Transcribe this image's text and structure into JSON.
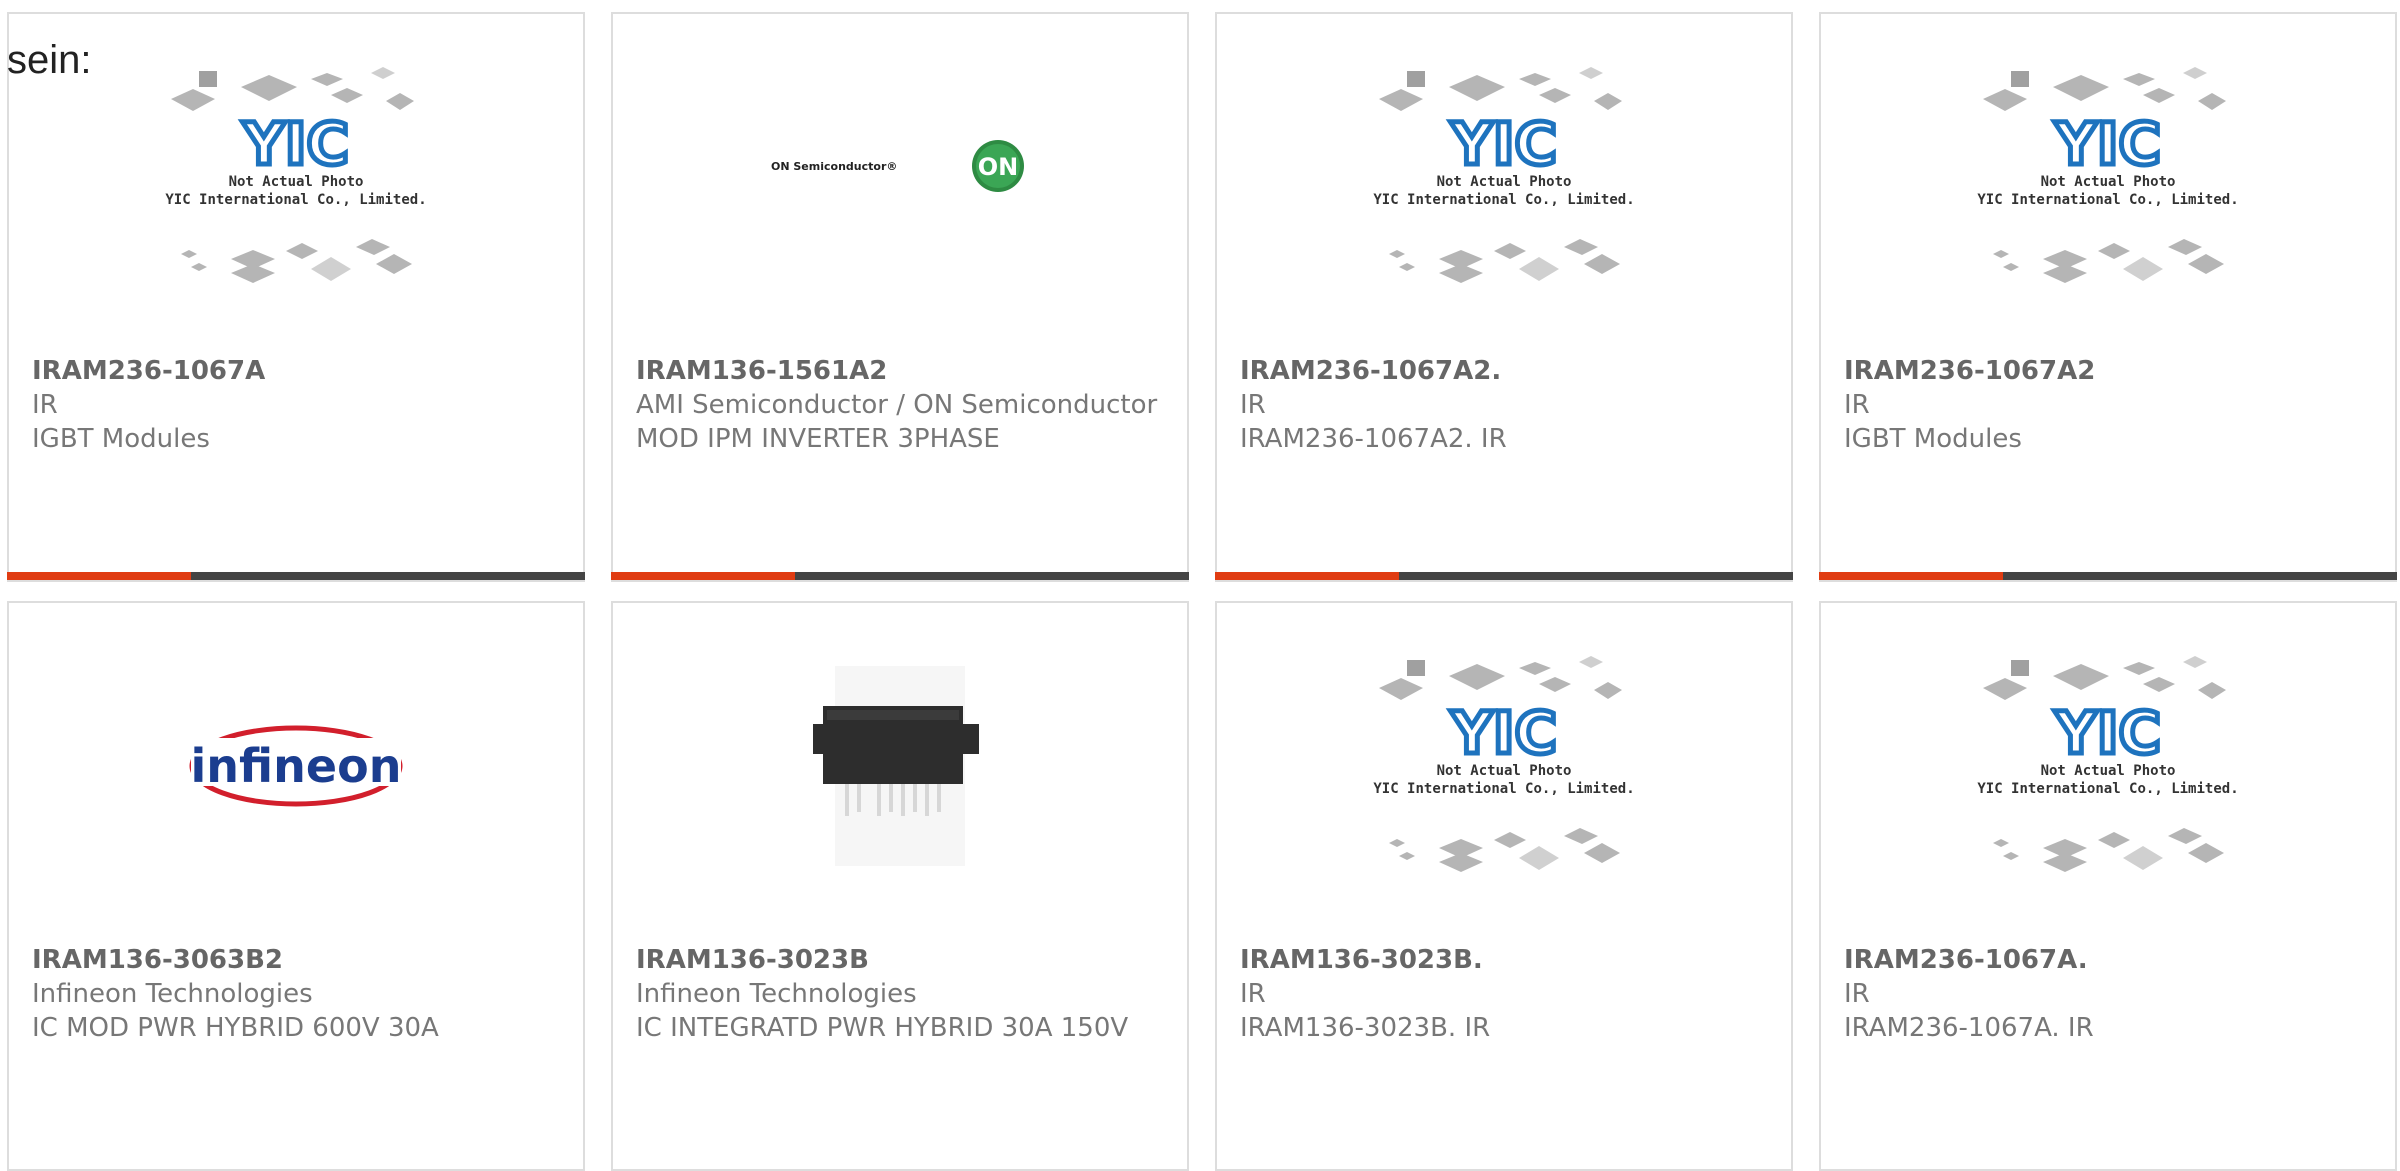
{
  "intro_text": "sein:",
  "products": [
    {
      "part": "IRAM236-1067A",
      "maker": "IR",
      "desc": "IGBT Modules",
      "image": "yic-placeholder",
      "photo": {
        "line1": "Not Actual Photo",
        "line2": "YIC International Co., Limited."
      }
    },
    {
      "part": "IRAM136-1561A2",
      "maker": "AMI Semiconductor / ON Semiconductor",
      "desc": "MOD IPM INVERTER 3PHASE",
      "image": "on-semiconductor-logo",
      "logo": {
        "text": "ON Semiconductor®",
        "badge": "ON"
      }
    },
    {
      "part": "IRAM236-1067A2.",
      "maker": "IR",
      "desc": "IRAM236-1067A2. IR",
      "image": "yic-placeholder",
      "photo": {
        "line1": "Not Actual Photo",
        "line2": "YIC International Co., Limited."
      }
    },
    {
      "part": "IRAM236-1067A2",
      "maker": "IR",
      "desc": "IGBT Modules",
      "image": "yic-placeholder",
      "photo": {
        "line1": "Not Actual Photo",
        "line2": "YIC International Co., Limited."
      }
    },
    {
      "part": "IRAM136-3063B2",
      "maker": "Infineon Technologies",
      "desc": "IC MOD PWR HYBRID 600V 30A",
      "image": "infineon-logo",
      "logo": {
        "text": "infineon"
      }
    },
    {
      "part": "IRAM136-3023B",
      "maker": "Infineon Technologies",
      "desc": "IC INTEGRATD PWR HYBRID 30A 150V",
      "image": "module-photo"
    },
    {
      "part": "IRAM136-3023B.",
      "maker": "IR",
      "desc": "IRAM136-3023B. IR",
      "image": "yic-placeholder",
      "photo": {
        "line1": "Not Actual Photo",
        "line2": "YIC International Co., Limited."
      }
    },
    {
      "part": "IRAM236-1067A.",
      "maker": "IR",
      "desc": "IRAM236-1067A. IR",
      "image": "yic-placeholder",
      "photo": {
        "line1": "Not Actual Photo",
        "line2": "YIC International Co., Limited."
      }
    }
  ],
  "colors": {
    "accent": "#e03c12",
    "bar": "#444444",
    "yic_blue": "#1e73be"
  }
}
